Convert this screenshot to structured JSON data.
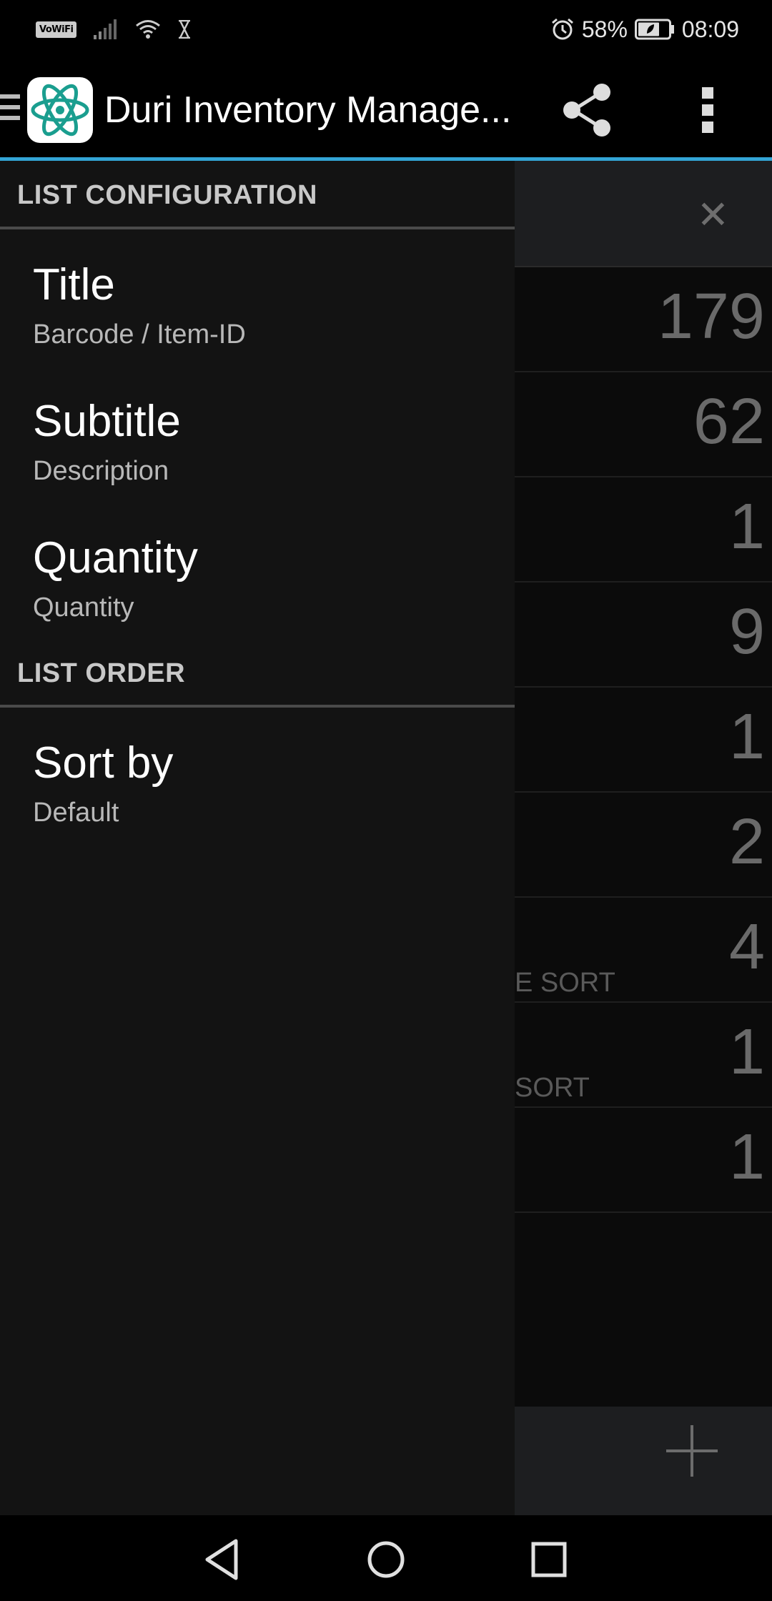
{
  "status_bar": {
    "left_badge": "VoWiFi",
    "battery": "58%",
    "time": "08:09",
    "icons": [
      "vowifi-icon",
      "signal-icon",
      "wifi-icon",
      "hourglass-icon",
      "alarm-icon",
      "battery-icon"
    ]
  },
  "app_bar": {
    "title": "Duri Inventory Manage...",
    "icons": [
      "menu-icon",
      "atom-app-icon",
      "share-icon",
      "more-vert-icon"
    ]
  },
  "drawer": {
    "sections": [
      {
        "header": "LIST CONFIGURATION",
        "items": [
          {
            "title": "Title",
            "subtitle": "Barcode / Item-ID"
          },
          {
            "title": "Subtitle",
            "subtitle": "Description"
          },
          {
            "title": "Quantity",
            "subtitle": "Quantity"
          }
        ]
      },
      {
        "header": "LIST ORDER",
        "items": [
          {
            "title": "Sort by",
            "subtitle": "Default"
          }
        ]
      }
    ]
  },
  "background_list": {
    "quantities": [
      "179",
      "62",
      "1",
      "9",
      "1",
      "2",
      "4",
      "1",
      "1"
    ],
    "sort_labels": [
      "E SORT",
      "SORT"
    ]
  },
  "colors": {
    "accent": "#33a5d6",
    "drawer_bg": "#131313",
    "app_icon_teal": "#1a9e8f"
  },
  "nav_bar": {
    "icons": [
      "back-icon",
      "home-icon",
      "recents-icon"
    ]
  }
}
